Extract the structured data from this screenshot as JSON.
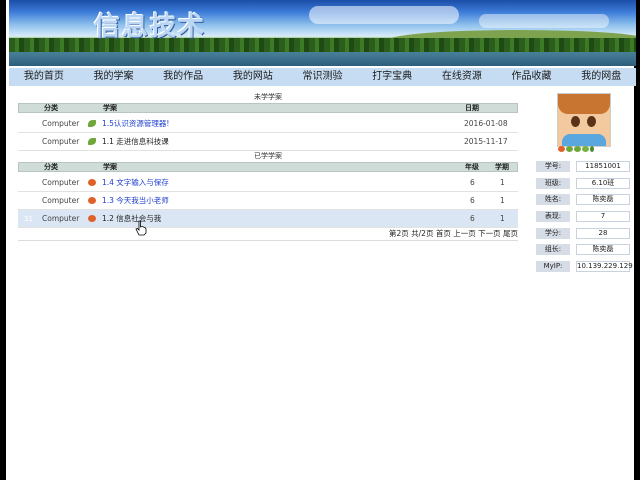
{
  "banner": {
    "logo_text": "信息技术"
  },
  "nav": [
    "我的首页",
    "我的学案",
    "我的作品",
    "我的网站",
    "常识测验",
    "打字宝典",
    "在线资源",
    "作品收藏",
    "我的网盘"
  ],
  "unlearned": {
    "title": "未学学案",
    "headers": {
      "category": "分类",
      "plan": "学案",
      "date": "日期"
    },
    "rows": [
      {
        "category": "Computer",
        "icon": "leaf-icon",
        "plan": "1.5认识资源管理器!",
        "date": "2016-01-08",
        "link": true
      },
      {
        "category": "Computer",
        "icon": "leaf-icon",
        "plan": "1.1 走进信息科技课",
        "date": "2015-11-17",
        "link": false
      }
    ]
  },
  "learned": {
    "title": "已学学案",
    "headers": {
      "category": "分类",
      "plan": "学案",
      "grade": "年级",
      "term": "学期"
    },
    "rows": [
      {
        "category": "Computer",
        "icon": "tomato-icon",
        "plan": "1.4 文字输入与保存",
        "grade": "6",
        "term": "1",
        "link": true,
        "num": ""
      },
      {
        "category": "Computer",
        "icon": "tomato-icon",
        "plan": "1.3 今天我当小老师",
        "grade": "6",
        "term": "1",
        "link": true,
        "num": ""
      },
      {
        "category": "Computer",
        "icon": "tomato-icon",
        "plan": "1.2 信息社会与我",
        "grade": "6",
        "term": "1",
        "link": false,
        "num": "31"
      }
    ],
    "pager": "第2页 共/2页 首页 上一页 下一页 尾页"
  },
  "profile": {
    "fields": [
      {
        "label": "学号:",
        "value": "11851001"
      },
      {
        "label": "班级:",
        "value": "6.10班"
      },
      {
        "label": "姓名:",
        "value": "陈奕磊"
      },
      {
        "label": "表现:",
        "value": "7"
      },
      {
        "label": "学分:",
        "value": "28"
      },
      {
        "label": "组长:",
        "value": "陈奕磊"
      },
      {
        "label": "MyIP:",
        "value": "10.139.229.129"
      }
    ]
  },
  "colors": {
    "nav_bg": "#c6dcf2",
    "link": "#1f3fcf",
    "highlight_row": "#dbe6f4",
    "header_bg": "#cfdcd8"
  }
}
